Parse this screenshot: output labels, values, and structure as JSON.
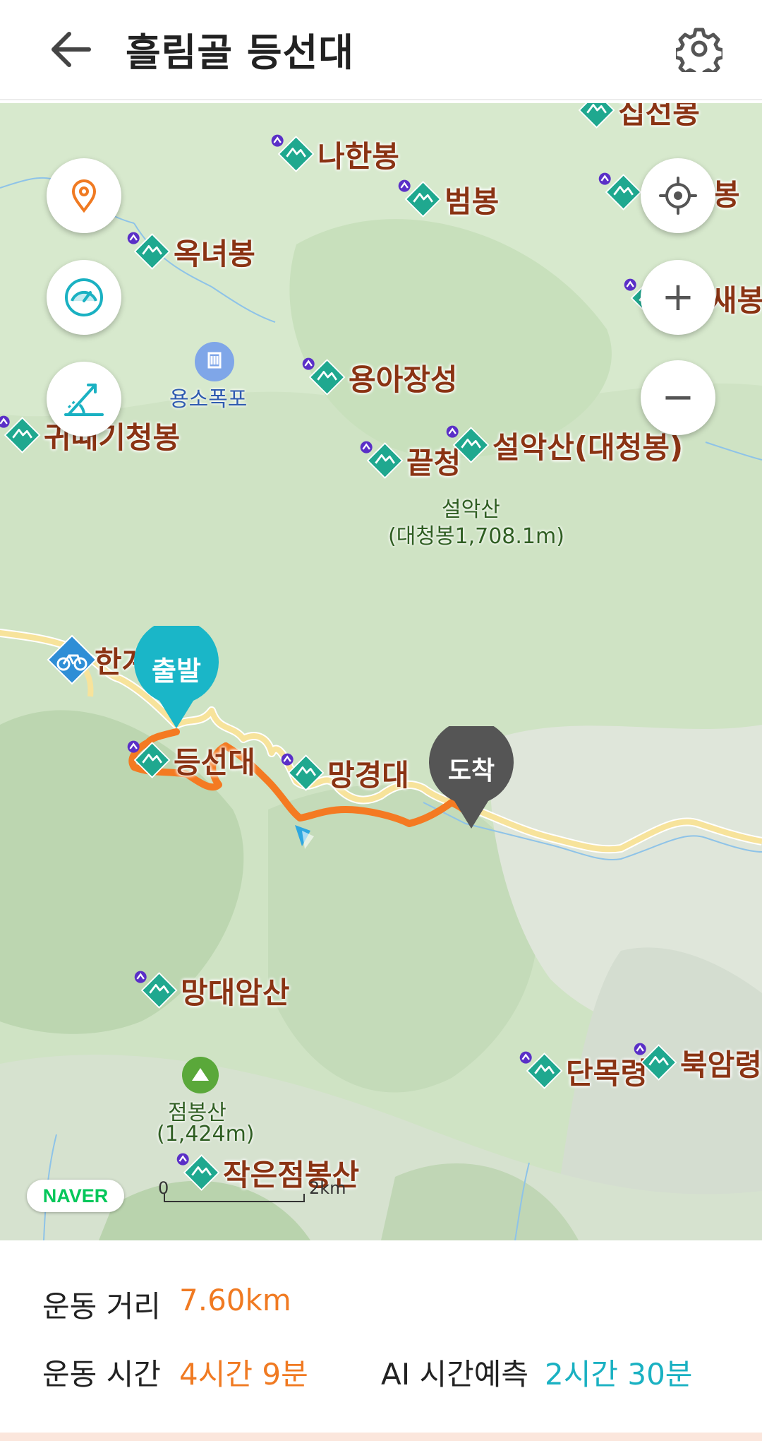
{
  "header": {
    "title": "흘림골 등선대"
  },
  "peaks": [
    {
      "key": "jipseon",
      "label": "집선봉"
    },
    {
      "key": "nahan",
      "label": "나한봉"
    },
    {
      "key": "beom",
      "label": "범봉"
    },
    {
      "key": "right1",
      "label": "봉"
    },
    {
      "key": "oknyeo",
      "label": "옥녀봉"
    },
    {
      "key": "right2",
      "label": "새봉"
    },
    {
      "key": "yonga",
      "label": "용아장성"
    },
    {
      "key": "gwittae",
      "label": "귀때기청봉"
    },
    {
      "key": "kkeutcheong",
      "label": "끝청"
    },
    {
      "key": "seorak",
      "label": "설악산(대청봉)"
    },
    {
      "key": "deungseon",
      "label": "등선대"
    },
    {
      "key": "manggyeong",
      "label": "망경대"
    },
    {
      "key": "mangdaeam",
      "label": "망대암산"
    },
    {
      "key": "danmok",
      "label": "단목령"
    },
    {
      "key": "bugam",
      "label": "북암령"
    },
    {
      "key": "jageunjeom",
      "label": "작은점봉산"
    }
  ],
  "pois": {
    "waterfall": "용소폭포",
    "seorak_name": "설악산",
    "seorak_elev": "(대청봉1,708.1m)",
    "jeombong_name": "점봉산",
    "jeombong_elev": "(1,424m)",
    "bike_label": "한계"
  },
  "markers": {
    "start": "출발",
    "end": "도착"
  },
  "map_controls": {
    "location_pin_icon": "location-pin-icon",
    "speed_icon": "speedometer-icon",
    "slope_icon": "elevation-slope-icon",
    "gps_icon": "gps-locate-icon",
    "zoom_in": "+",
    "zoom_out": "−"
  },
  "scale": {
    "zero": "0",
    "max": "2km"
  },
  "brand": "NAVER",
  "stats": {
    "distance_label": "운동 거리",
    "distance_value": "7.60km",
    "time_label": "운동 시간",
    "time_value": "4시간 9분",
    "ai_label": "AI 시간예측",
    "ai_value": "2시간 30분"
  },
  "colors": {
    "route": "#f47a22",
    "start": "#1ab6c8",
    "end": "#555555",
    "peak_label": "#8a3313",
    "teal": "#1ab1c2",
    "orange": "#f07a22"
  }
}
